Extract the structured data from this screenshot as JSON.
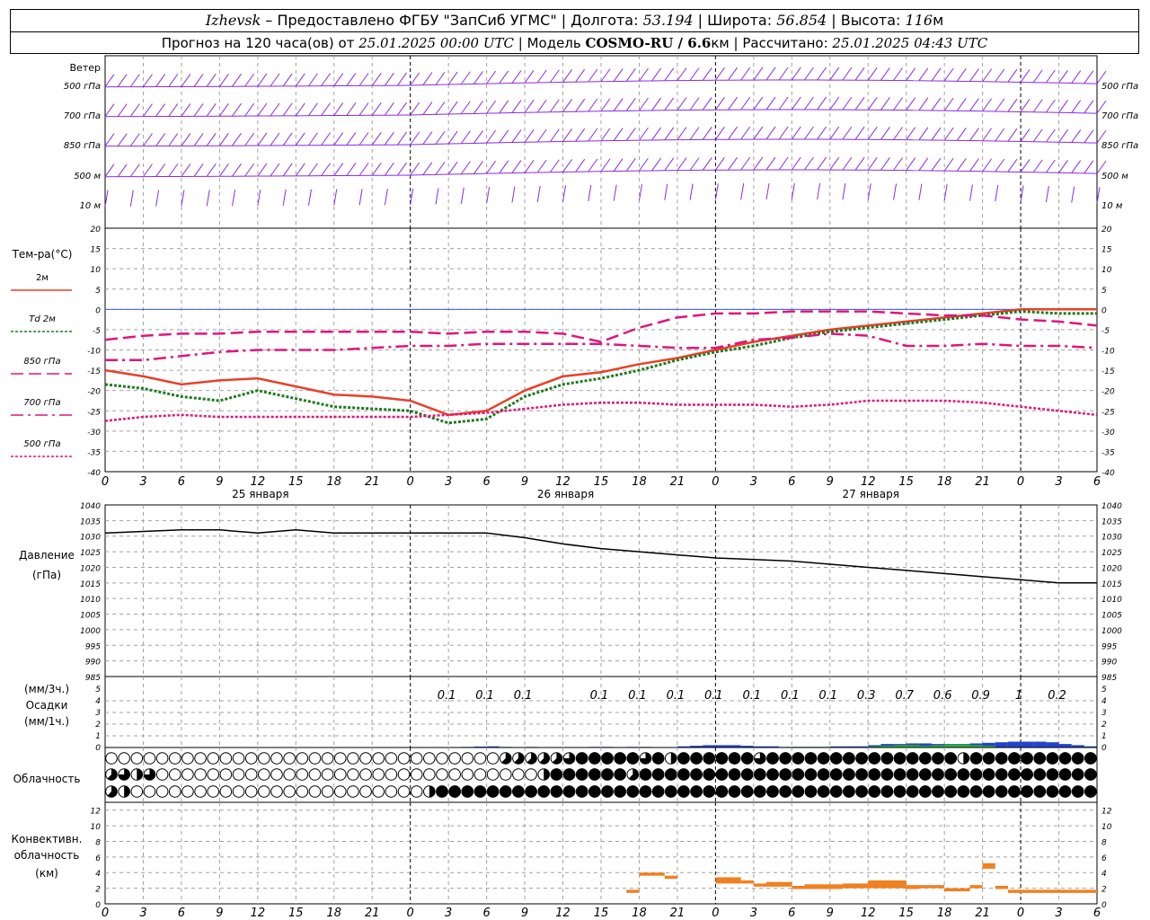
{
  "header": {
    "city": "Izhevsk",
    "provider": " – Предоставлено ФГБУ \"ЗапСиб УГМС\" | Долгота: ",
    "lon": "53.194",
    "lat_label": " | Широта: ",
    "lat": "56.854",
    "alt_label": " | Высота: ",
    "alt": "116",
    "alt_unit": "м",
    "forecast_label": "Прогноз на 120 часа(ов) от ",
    "forecast_time": "25.01.2025 00:00 UTC",
    "model_label": "  | Модель ",
    "model": "COSMO-RU / 6.6",
    "model_unit": "км",
    "calc_label": " | Рассчитано: ",
    "calc_time": "25.01.2025 04:43 UTC"
  },
  "colors": {
    "wind": "#8a2be2",
    "t2m": "#e8402a",
    "td2m": "#1f7a1f",
    "t850": "#e0157f",
    "t700": "#e0157f",
    "t500": "#e0157f",
    "pressure": "#000000",
    "precip_blue": "#2244cc",
    "precip_green": "#2bb52b",
    "convective": "#f08020",
    "grid": "#a0a0a0",
    "zero_line": "#3355ff"
  },
  "x_axis": {
    "hour_ticks": [
      "0",
      "3",
      "6",
      "9",
      "12",
      "15",
      "18",
      "21",
      "0",
      "3",
      "6",
      "9",
      "12",
      "15",
      "18",
      "21",
      "0",
      "3",
      "6",
      "9",
      "12",
      "15",
      "18",
      "21",
      "0",
      "3",
      "6"
    ],
    "dates": [
      "25 января",
      "26 января",
      "27 января"
    ]
  },
  "wind_panel": {
    "title": "Ветер",
    "levels": [
      "500 гПа",
      "700 гПа",
      "850 гПа",
      "500 м",
      "10 м"
    ]
  },
  "chart_data": [
    {
      "type": "line",
      "title": "Тем-ра(°C)",
      "ylim": [
        -40,
        20
      ],
      "yticks": [
        "20",
        "15",
        "10",
        "5",
        "0",
        "-5",
        "-10",
        "-15",
        "-20",
        "-25",
        "-30",
        "-35",
        "-40"
      ],
      "grid": true,
      "legend_placement": "left",
      "x": [
        0,
        3,
        6,
        9,
        12,
        15,
        18,
        21,
        24,
        27,
        30,
        33,
        36,
        39,
        42,
        45,
        48,
        51,
        54,
        57,
        60,
        63,
        66,
        69,
        72,
        75,
        78
      ],
      "series": [
        {
          "name": "2м",
          "style": "solid",
          "values": [
            -15,
            -16.5,
            -18.5,
            -17.5,
            -17,
            -19,
            -21,
            -21.5,
            -22.5,
            -26,
            -25,
            -20,
            -16.5,
            -15.5,
            -13.5,
            -12,
            -10,
            -8,
            -6.5,
            -5,
            -4,
            -3,
            -2,
            -1,
            0,
            0,
            0
          ]
        },
        {
          "name": "Td 2м",
          "style": "dotted",
          "values": [
            -18.5,
            -19.5,
            -21.5,
            -22.5,
            -20,
            -22,
            -24,
            -24.5,
            -25,
            -28,
            -27,
            -21.5,
            -18.5,
            -17,
            -15,
            -12.5,
            -10.5,
            -9,
            -7,
            -5.5,
            -4.5,
            -3.5,
            -2.5,
            -1.5,
            -0.5,
            -1,
            -1
          ]
        },
        {
          "name": "850 гПа",
          "style": "dashed",
          "values": [
            -7.5,
            -6.5,
            -6,
            -6,
            -5.5,
            -5.5,
            -5.5,
            -5.5,
            -5.5,
            -6,
            -5.5,
            -5.5,
            -6,
            -8,
            -4.5,
            -2,
            -1,
            -1,
            -0.5,
            -0.5,
            -0.5,
            -1,
            -1.5,
            -1.5,
            -2.5,
            -3,
            -4
          ]
        },
        {
          "name": "700 гПа",
          "style": "dashdot",
          "values": [
            -12.5,
            -12.5,
            -11.5,
            -10.5,
            -10,
            -10,
            -10,
            -9.5,
            -9,
            -9,
            -8.5,
            -8.5,
            -8.5,
            -8.5,
            -9,
            -9.5,
            -9.5,
            -7.5,
            -7,
            -6,
            -6.5,
            -9,
            -9,
            -8.5,
            -9,
            -9,
            -9.5
          ]
        },
        {
          "name": "500 гПа",
          "style": "dotted",
          "values": [
            -27.5,
            -26.5,
            -26,
            -26.5,
            -26.5,
            -26.5,
            -26.5,
            -26.5,
            -26.5,
            -26,
            -25.5,
            -24.5,
            -23.5,
            -23,
            -23,
            -23.5,
            -23.5,
            -23.5,
            -24,
            -23.5,
            -22.5,
            -22.5,
            -22.5,
            -23,
            -24,
            -25,
            -26
          ]
        }
      ]
    },
    {
      "type": "line",
      "title": "Давление",
      "ylabel": "(гПа)",
      "ylim": [
        985,
        1040
      ],
      "yticks": [
        "1040",
        "1035",
        "1030",
        "1025",
        "1020",
        "1015",
        "1010",
        "1005",
        "1000",
        "995",
        "990",
        "985"
      ],
      "grid": true,
      "x": [
        0,
        3,
        6,
        9,
        12,
        15,
        18,
        21,
        24,
        27,
        30,
        33,
        36,
        39,
        42,
        45,
        48,
        51,
        54,
        57,
        60,
        63,
        66,
        69,
        72,
        75,
        78
      ],
      "values": [
        1031,
        1031.5,
        1032,
        1032,
        1031,
        1032,
        1031,
        1031,
        1031,
        1031,
        1031,
        1029.5,
        1027.5,
        1026,
        1025,
        1024,
        1023,
        1022.5,
        1022,
        1021,
        1020,
        1019,
        1018,
        1017,
        1016,
        1015,
        1015
      ]
    },
    {
      "type": "bar",
      "title": "Осадки",
      "ylabel": "(мм/3ч.)",
      "ylabel2": "(мм/1ч.)",
      "ylim": [
        0,
        5
      ],
      "yticks": [
        "5",
        "4",
        "3",
        "2",
        "1",
        "0"
      ],
      "labels_x": [
        27,
        30,
        33,
        39,
        42,
        45,
        48,
        51,
        54,
        57,
        60,
        63,
        66,
        69,
        72,
        75
      ],
      "labels": [
        "0.1",
        "0.1",
        "0.1",
        "0.1",
        "0.1",
        "0.1",
        "0.1",
        "0.1",
        "0.1",
        "0.1",
        "0.3",
        "0.7",
        "0.6",
        "0.9",
        "1",
        "0.2"
      ],
      "hourly_x": [
        29,
        30,
        31,
        32,
        34,
        39,
        40,
        42,
        43,
        46,
        47,
        48,
        49,
        50,
        51,
        52,
        53,
        54,
        55,
        56,
        57,
        58,
        59,
        60,
        61,
        62,
        63,
        64,
        65,
        66,
        67,
        68,
        69,
        70,
        71,
        72,
        73,
        74,
        75,
        76,
        77,
        78
      ],
      "hourly_values": [
        0.05,
        0.08,
        0.1,
        0.05,
        0.05,
        0.05,
        0.05,
        0.05,
        0.05,
        0.1,
        0.15,
        0.2,
        0.2,
        0.2,
        0.15,
        0.1,
        0.1,
        0.05,
        0.05,
        0.05,
        0.05,
        0.1,
        0.1,
        0.1,
        0.2,
        0.3,
        0.3,
        0.35,
        0.35,
        0.3,
        0.3,
        0.3,
        0.35,
        0.4,
        0.45,
        0.5,
        0.5,
        0.5,
        0.45,
        0.3,
        0.2,
        0.1
      ],
      "hourly_green_x": [
        55,
        56,
        57,
        58,
        61,
        62,
        63,
        64,
        65,
        66,
        67,
        68,
        69,
        70
      ],
      "hourly_green_values": [
        0.05,
        0.05,
        0.05,
        0.05,
        0.1,
        0.15,
        0.2,
        0.2,
        0.15,
        0.2,
        0.25,
        0.25,
        0.2,
        0.15
      ]
    },
    {
      "type": "table",
      "title": "Облачность",
      "note": "cloud cover octas per row (high, middle, low), hourly",
      "rows": [
        [
          0,
          0,
          0,
          0,
          0,
          0,
          0,
          0,
          0,
          0,
          0,
          0,
          0,
          0,
          0,
          0,
          0,
          0,
          0,
          0,
          0,
          0,
          0,
          0,
          0,
          0,
          0,
          0,
          0,
          0,
          0,
          0,
          0,
          0,
          0,
          0,
          0,
          0,
          0,
          0,
          0,
          0,
          0,
          0,
          0,
          0,
          0,
          0,
          0,
          0,
          0,
          0,
          0,
          0,
          0,
          0,
          0,
          0,
          0,
          0,
          0,
          6,
          5,
          6,
          5,
          6,
          5,
          5,
          5,
          4,
          5,
          3,
          6,
          8,
          8,
          8,
          8,
          8,
          8,
          8,
          8,
          8,
          8,
          8,
          6,
          8,
          8,
          8,
          4,
          4,
          8,
          8,
          8,
          6,
          8,
          8,
          8,
          8,
          8,
          8,
          8,
          8,
          6,
          8,
          8,
          8,
          8,
          8,
          8,
          8,
          8,
          8,
          8,
          8,
          8,
          4,
          8,
          8,
          8,
          8,
          8,
          8,
          8,
          8,
          8,
          8,
          8,
          8,
          8,
          4,
          8,
          8,
          8,
          4,
          4,
          8,
          8,
          8,
          8,
          8,
          8,
          8,
          8,
          8,
          8,
          8,
          8,
          8,
          8,
          8,
          8,
          8,
          8,
          8,
          8,
          8,
          8,
          8,
          8,
          8
        ],
        [
          5,
          6,
          6,
          4,
          4,
          6,
          6,
          5,
          0,
          0,
          0,
          0,
          0,
          0,
          0,
          0,
          0,
          0,
          0,
          0,
          0,
          0,
          0,
          0,
          0,
          0,
          0,
          0,
          0,
          0,
          0,
          0,
          0,
          0,
          0,
          0,
          0,
          0,
          0,
          0,
          0,
          0,
          0,
          0,
          0,
          0,
          0,
          0,
          0,
          0,
          0,
          0,
          0,
          0,
          0,
          0,
          0,
          0,
          0,
          0,
          0,
          0,
          0,
          0,
          0,
          0,
          0,
          4,
          4,
          6,
          8,
          8,
          8,
          8,
          8,
          8,
          8,
          8,
          8,
          8,
          8,
          8,
          5,
          5,
          8,
          8,
          8,
          8,
          8,
          8,
          8,
          8,
          8,
          8,
          8,
          8,
          8,
          8,
          8,
          8,
          8,
          8,
          8,
          8,
          8,
          8,
          8,
          8,
          8,
          8,
          8,
          8,
          8,
          8,
          8,
          8,
          8,
          8,
          8,
          8,
          8,
          8,
          8,
          8,
          8,
          8,
          8,
          8,
          8,
          8,
          8,
          8,
          8,
          8,
          8,
          8,
          8,
          8,
          8,
          8,
          8,
          8,
          8,
          8,
          8,
          8,
          8,
          8,
          8,
          8,
          8,
          8,
          8,
          8,
          8,
          8,
          8,
          8,
          8,
          8,
          8,
          8,
          8
        ],
        [
          5,
          5,
          4,
          0,
          0,
          0,
          0,
          0,
          0,
          0,
          0,
          0,
          0,
          0,
          0,
          0,
          0,
          0,
          0,
          0,
          0,
          0,
          0,
          0,
          0,
          0,
          0,
          0,
          0,
          0,
          0,
          0,
          0,
          0,
          0,
          0,
          0,
          0,
          0,
          0,
          0,
          0,
          0,
          0,
          0,
          0,
          0,
          0,
          0,
          0,
          4,
          8,
          8,
          8,
          8,
          8,
          8,
          8,
          8,
          8,
          8,
          8,
          8,
          8,
          8,
          8,
          8,
          8,
          8,
          8,
          8,
          8,
          8,
          8,
          8,
          8,
          8,
          8,
          8,
          8,
          8,
          8,
          8,
          8,
          8,
          8,
          8,
          8,
          8,
          8,
          8,
          8,
          8,
          8,
          8,
          8,
          8,
          8,
          8,
          8,
          8,
          8,
          8,
          8,
          8,
          8,
          8,
          8,
          8,
          8,
          8,
          8,
          8,
          8,
          8,
          8,
          8,
          8,
          8,
          8,
          8,
          8,
          8,
          8,
          8,
          8,
          8,
          8,
          8,
          8,
          8,
          8,
          8,
          8,
          8,
          8,
          8,
          8,
          8,
          8,
          8,
          8,
          8,
          8,
          8,
          8,
          8,
          8,
          8,
          8,
          8,
          8,
          8,
          8,
          8,
          8,
          8,
          8,
          8,
          8,
          8,
          8
        ]
      ]
    },
    {
      "type": "bar",
      "title": "Конвективн. облачность",
      "ylabel": "(км)",
      "ylim": [
        0,
        13
      ],
      "yticks": [
        "12",
        "10",
        "8",
        "6",
        "4",
        "2",
        "0"
      ],
      "segments": [
        {
          "x0": 41,
          "x1": 42,
          "base": 1.4,
          "top": 1.8
        },
        {
          "x0": 42,
          "x1": 44,
          "base": 3.6,
          "top": 4.0
        },
        {
          "x0": 44,
          "x1": 45,
          "base": 3.2,
          "top": 3.6
        },
        {
          "x0": 48,
          "x1": 50,
          "base": 2.6,
          "top": 3.4
        },
        {
          "x0": 50,
          "x1": 51,
          "base": 2.6,
          "top": 3.0
        },
        {
          "x0": 51,
          "x1": 52,
          "base": 2.2,
          "top": 2.6
        },
        {
          "x0": 52,
          "x1": 54,
          "base": 2.2,
          "top": 2.8
        },
        {
          "x0": 54,
          "x1": 55,
          "base": 1.9,
          "top": 2.3
        },
        {
          "x0": 55,
          "x1": 58,
          "base": 1.9,
          "top": 2.5
        },
        {
          "x0": 58,
          "x1": 60,
          "base": 2.0,
          "top": 2.6
        },
        {
          "x0": 60,
          "x1": 63,
          "base": 2.0,
          "top": 3.0
        },
        {
          "x0": 63,
          "x1": 64,
          "base": 1.9,
          "top": 2.4
        },
        {
          "x0": 64,
          "x1": 66,
          "base": 2.0,
          "top": 2.4
        },
        {
          "x0": 66,
          "x1": 68,
          "base": 1.6,
          "top": 2.0
        },
        {
          "x0": 68,
          "x1": 69,
          "base": 2.0,
          "top": 2.4
        },
        {
          "x0": 69,
          "x1": 70,
          "base": 4.5,
          "top": 5.2
        },
        {
          "x0": 70,
          "x1": 71,
          "base": 1.9,
          "top": 2.3
        },
        {
          "x0": 71,
          "x1": 78,
          "base": 1.4,
          "top": 1.8
        }
      ]
    }
  ]
}
